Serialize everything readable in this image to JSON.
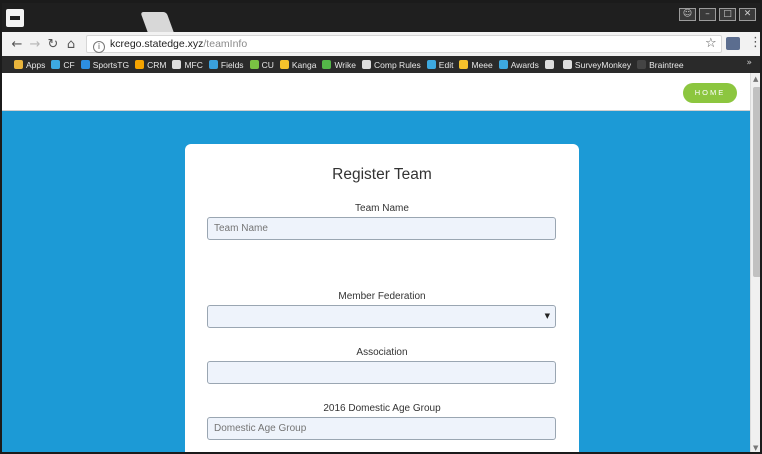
{
  "browser": {
    "address": {
      "host": "kcrego.statedge.xyz",
      "path": "/teamInfo"
    },
    "bookmarks": [
      {
        "label": "Apps",
        "color": "#e8b43c"
      },
      {
        "label": "CF",
        "color": "#3da9e0"
      },
      {
        "label": "SportsTG",
        "color": "#2d8ee0"
      },
      {
        "label": "CRM",
        "color": "#f5a300"
      },
      {
        "label": "MFC",
        "color": "#dddddd"
      },
      {
        "label": "Fields",
        "color": "#3aa0dc"
      },
      {
        "label": "CU",
        "color": "#7ac143"
      },
      {
        "label": "Kanga",
        "color": "#f6c22c"
      },
      {
        "label": "Wrike",
        "color": "#54b848"
      },
      {
        "label": "Comp Rules",
        "color": "#dddddd"
      },
      {
        "label": "Edit",
        "color": "#3da9e0"
      },
      {
        "label": "Meee",
        "color": "#f6c22c"
      },
      {
        "label": "Awards",
        "color": "#3da9e0"
      },
      {
        "label": "",
        "color": "#dddddd"
      },
      {
        "label": "SurveyMonkey",
        "color": "#dddddd"
      },
      {
        "label": "Braintree",
        "color": "#444444"
      }
    ]
  },
  "header": {
    "home_label": "HOME"
  },
  "form": {
    "title": "Register Team",
    "team_name": {
      "label": "Team Name",
      "placeholder": "Team Name"
    },
    "member_federation": {
      "label": "Member Federation",
      "value": ""
    },
    "association": {
      "label": "Association",
      "value": ""
    },
    "domestic_age_group": {
      "label": "2016 Domestic Age Group",
      "placeholder": "Domestic Age Group"
    }
  },
  "colors": {
    "page_bg": "#1c9ad6",
    "home_button": "#8cc63f"
  }
}
